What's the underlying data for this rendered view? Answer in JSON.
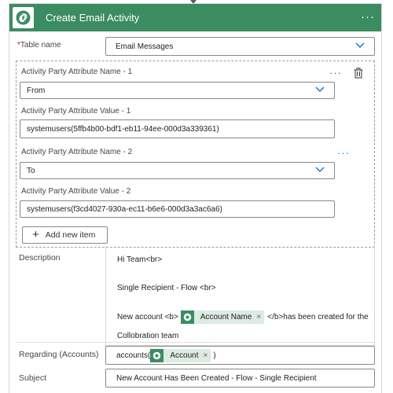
{
  "header": {
    "title": "Create Email Activity",
    "more": "···",
    "accent": "#3c8c61"
  },
  "table_name": {
    "label": "Table name",
    "required": "*",
    "value": "Email Messages"
  },
  "activity_party": {
    "items": [
      {
        "name_label": "Activity Party Attribute Name - 1",
        "name_value": "From",
        "value_label": "Activity Party Attribute Value - 1",
        "value_value": "systemusers(5ffb4b00-bdf1-eb11-94ee-000d3a339361)"
      },
      {
        "name_label": "Activity Party Attribute Name - 2",
        "name_value": "To",
        "value_label": "Activity Party Attribute Value - 2",
        "value_value": "systemusers(f3cd4027-930a-ec11-b6e6-000d3a3ac6a6)"
      }
    ],
    "dots": "···",
    "add_label": "Add new item"
  },
  "description": {
    "label": "Description",
    "line1": "Hi Team<br>",
    "line2": "Single Recipient - Flow <br>",
    "line3_pre": "New account <b>",
    "token": "Account Name",
    "token_x": "×",
    "line3_post": "</b>has been created for the",
    "line4": "Collobration team"
  },
  "regarding": {
    "label": "Regarding (Accounts)",
    "pre": "accounts(",
    "token": "Account",
    "token_x": "×",
    "post": ")"
  },
  "subject": {
    "label": "Subject",
    "value": "New Account Has Been Created - Flow - Single Recipient"
  },
  "icons": [
    "dataverse-icon",
    "more-icon",
    "chevron-down-icon",
    "delete-icon",
    "plus-icon"
  ]
}
